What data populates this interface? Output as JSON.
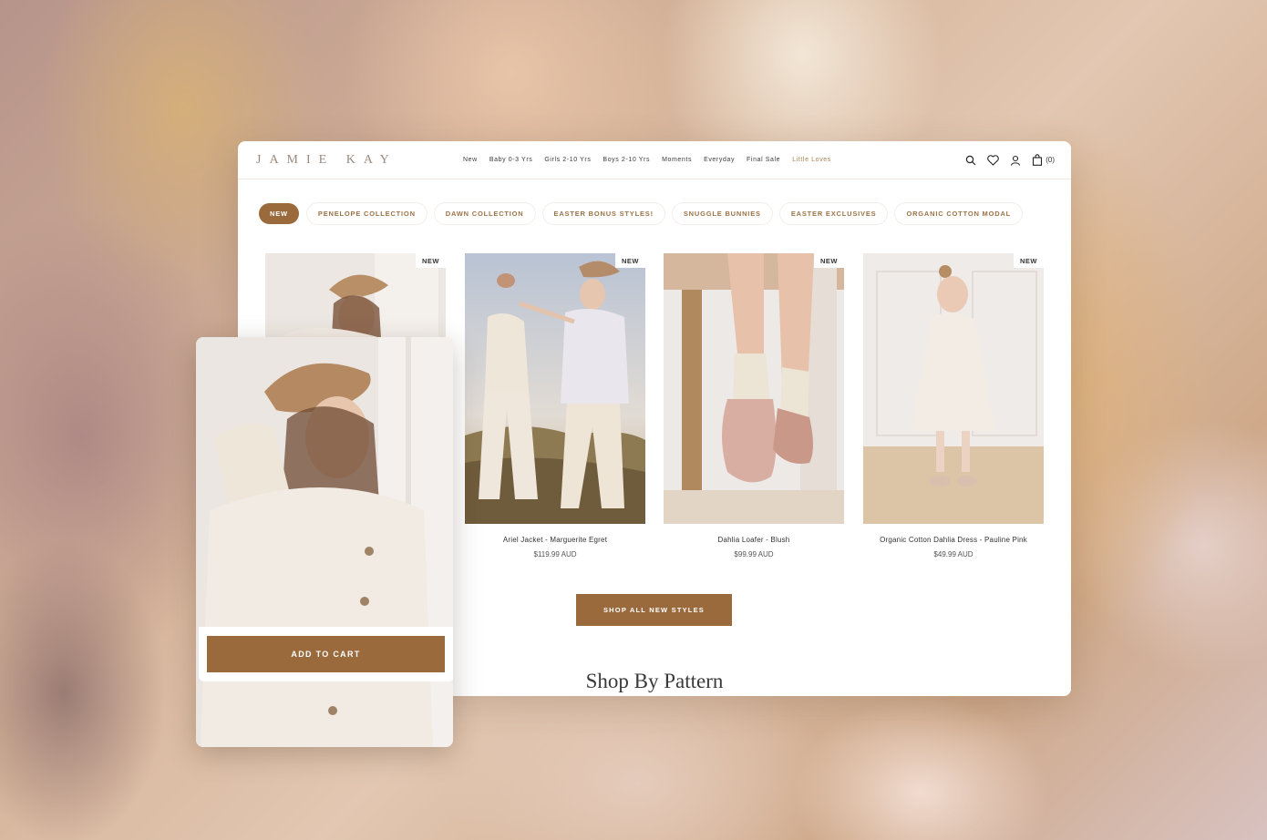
{
  "brand": {
    "logo": "JAMIE KAY"
  },
  "nav": {
    "items": [
      "New",
      "Baby 0-3 Yrs",
      "Girls 2-10 Yrs",
      "Boys 2-10 Yrs",
      "Moments",
      "Everyday",
      "Final Sale",
      "Little Loves"
    ],
    "accent_item": "Little Loves"
  },
  "header": {
    "cart_count": "(0)"
  },
  "filters": {
    "pills": [
      "NEW",
      "PENELOPE COLLECTION",
      "DAWN COLLECTION",
      "EASTER BONUS STYLES!",
      "SNUGGLE BUNNIES",
      "EASTER EXCLUSIVES",
      "ORGANIC COTTON MODAL"
    ],
    "active": "NEW"
  },
  "products": [
    {
      "badge": "NEW",
      "name": "",
      "price": ""
    },
    {
      "badge": "NEW",
      "name": "Ariel Jacket - Marguerite Egret",
      "price": "$119.99 AUD"
    },
    {
      "badge": "NEW",
      "name": "Dahlia Loafer - Blush",
      "price": "$99.99 AUD"
    },
    {
      "badge": "NEW",
      "name": "Organic Cotton Dahlia Dress - Pauline Pink",
      "price": "$49.99 AUD"
    }
  ],
  "cta": {
    "shop_all": "SHOP ALL NEW STYLES"
  },
  "section": {
    "title": "Shop By Pattern"
  },
  "quick_add": {
    "button": "ADD TO CART"
  },
  "colors": {
    "accent": "#9a6a3d",
    "accent_text": "#9a7449",
    "nav_accent": "#a98052"
  },
  "icons": [
    "search-icon",
    "heart-icon",
    "user-icon",
    "bag-icon"
  ]
}
